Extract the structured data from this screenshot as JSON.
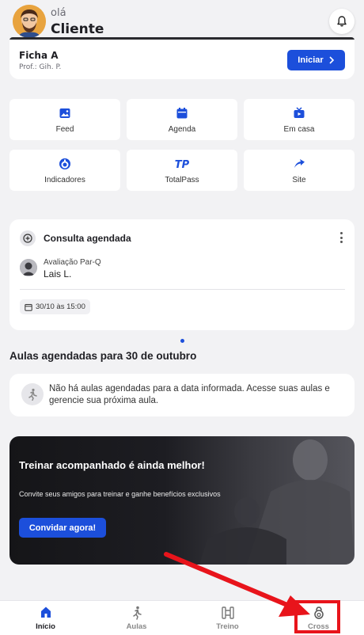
{
  "header": {
    "greeting": "olá",
    "user_name": "Cliente",
    "avatar_icon": "user-avatar",
    "bell_icon": "bell-icon"
  },
  "ficha": {
    "title": "Ficha A",
    "subtitle": "Prof.: Gih. P.",
    "button_label": "Iniciar"
  },
  "shortcuts": [
    {
      "label": "Feed",
      "icon": "image-icon"
    },
    {
      "label": "Agenda",
      "icon": "calendar-icon"
    },
    {
      "label": "Em casa",
      "icon": "tv-icon"
    },
    {
      "label": "Indicadores",
      "icon": "gauge-icon"
    },
    {
      "label": "TotalPass",
      "icon": "totalpass-icon"
    },
    {
      "label": "Site",
      "icon": "external-link-icon"
    }
  ],
  "consulta": {
    "title": "Consulta agendada",
    "type": "Avaliação Par-Q",
    "person": "Lais L.",
    "date": "30/10 às 15:00"
  },
  "aulas": {
    "section_title": "Aulas agendadas para 30 de outubro",
    "empty_message": "Não há aulas agendadas para a data informada. Acesse suas aulas e gerencie sua próxima aula."
  },
  "promo": {
    "title": "Treinar acompanhado é ainda melhor!",
    "subtitle": "Convite seus amigos para treinar e ganhe benefícios exclusivos",
    "button_label": "Convidar agora!"
  },
  "nav": {
    "items": [
      {
        "label": "Início",
        "icon": "home-icon",
        "active": true
      },
      {
        "label": "Aulas",
        "icon": "running-icon",
        "active": false
      },
      {
        "label": "Treino",
        "icon": "dumbbell-icon",
        "active": false
      },
      {
        "label": "Cross",
        "icon": "kettlebell-icon",
        "active": false
      }
    ]
  },
  "colors": {
    "accent": "#1c4fdb",
    "highlight": "#e8141b",
    "background": "#f2f2f4"
  }
}
